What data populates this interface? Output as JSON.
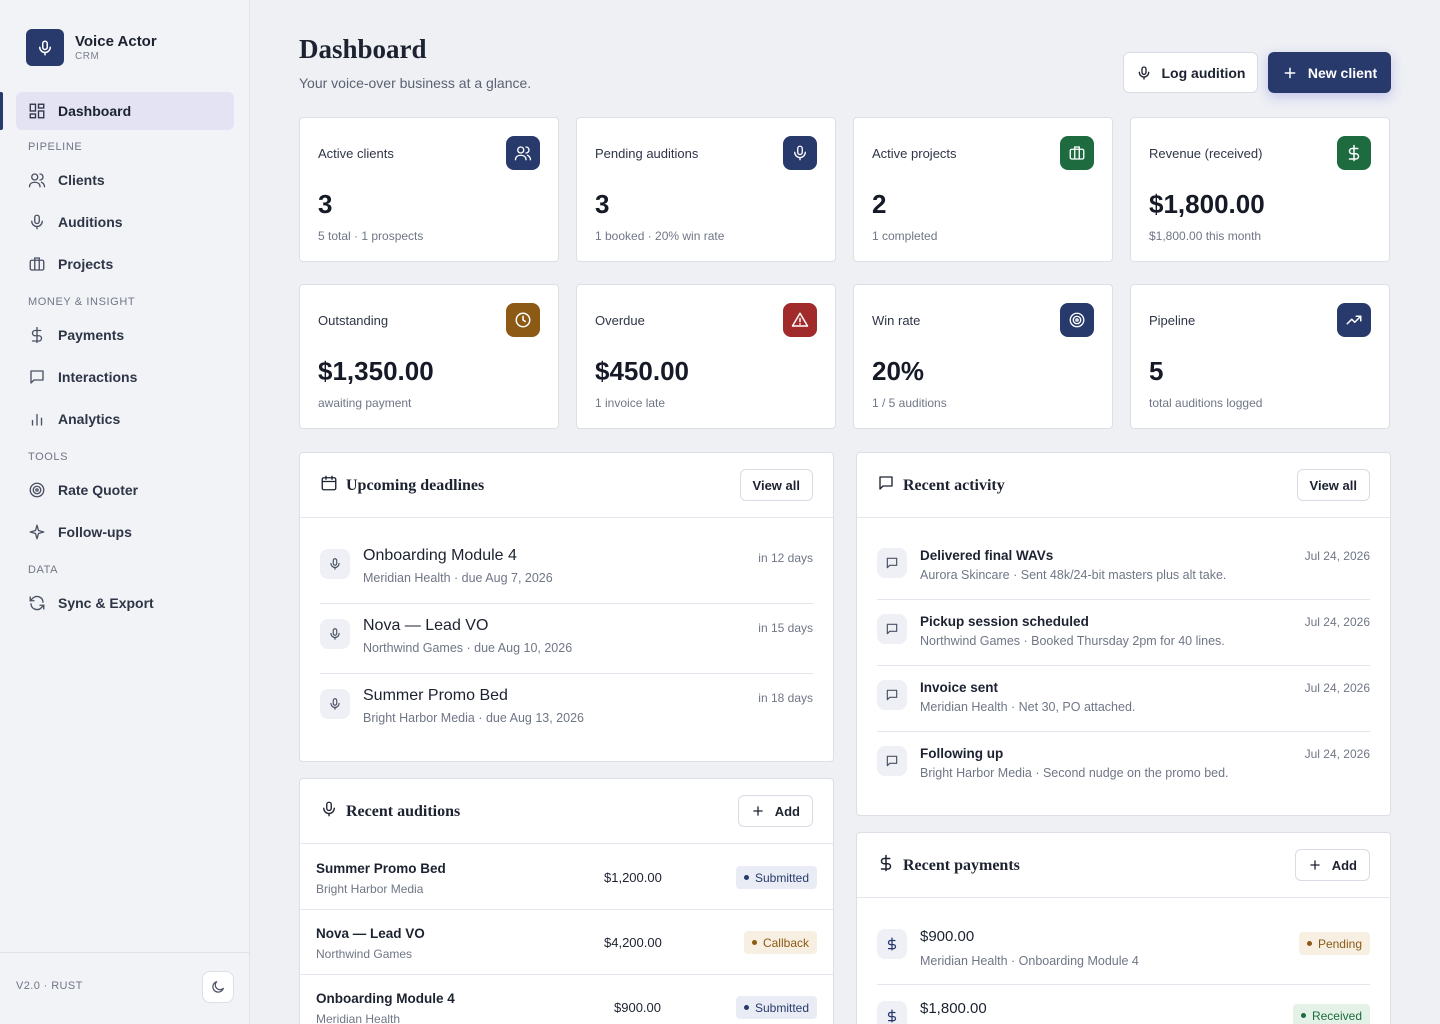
{
  "brand": {
    "title": "Voice Actor",
    "subtitle": "CRM"
  },
  "nav": {
    "dashboard": "Dashboard",
    "pipeline_label": "PIPELINE",
    "clients": "Clients",
    "auditions": "Auditions",
    "projects": "Projects",
    "money_label": "MONEY & INSIGHT",
    "payments": "Payments",
    "interactions": "Interactions",
    "analytics": "Analytics",
    "tools_label": "TOOLS",
    "rate_quoter": "Rate Quoter",
    "followups": "Follow-ups",
    "data_label": "DATA",
    "sync": "Sync & Export"
  },
  "footer": {
    "version": "V2.0 · RUST"
  },
  "header": {
    "title": "Dashboard",
    "subtitle": "Your voice-over business at a glance.",
    "log_audition": "Log audition",
    "new_client": "New client"
  },
  "stats": [
    {
      "label": "Active clients",
      "value": "3",
      "note": "5 total · 1 prospects",
      "icon": "users-icon",
      "color": "#283a6b"
    },
    {
      "label": "Pending auditions",
      "value": "3",
      "note": "1 booked · 20% win rate",
      "icon": "mic-icon",
      "color": "#283a6b"
    },
    {
      "label": "Active projects",
      "value": "2",
      "note": "1 completed",
      "icon": "briefcase-icon",
      "color": "#1d6b3e"
    },
    {
      "label": "Revenue (received)",
      "value": "$1,800.00",
      "note": "$1,800.00 this month",
      "icon": "dollar-icon",
      "color": "#1d6b3e"
    },
    {
      "label": "Outstanding",
      "value": "$1,350.00",
      "note": "awaiting payment",
      "icon": "clock-icon",
      "color": "#8c5a15"
    },
    {
      "label": "Overdue",
      "value": "$450.00",
      "note": "1 invoice late",
      "icon": "alert-icon",
      "color": "#a12a2a"
    },
    {
      "label": "Win rate",
      "value": "20%",
      "note": "1 / 5 auditions",
      "icon": "target-icon",
      "color": "#283a6b"
    },
    {
      "label": "Pipeline",
      "value": "5",
      "note": "total auditions logged",
      "icon": "trend-icon",
      "color": "#283a6b"
    }
  ],
  "deadlines": {
    "title": "Upcoming deadlines",
    "view_all": "View all",
    "items": [
      {
        "title": "Onboarding Module 4",
        "sub": "Meridian Health · due Aug 7, 2026",
        "when": "in 12 days"
      },
      {
        "title": "Nova — Lead VO",
        "sub": "Northwind Games · due Aug 10, 2026",
        "when": "in 15 days"
      },
      {
        "title": "Summer Promo Bed",
        "sub": "Bright Harbor Media · due Aug 13, 2026",
        "when": "in 18 days"
      }
    ]
  },
  "activity": {
    "title": "Recent activity",
    "view_all": "View all",
    "items": [
      {
        "title": "Delivered final WAVs",
        "sub": "Aurora Skincare · Sent 48k/24-bit masters plus alt take.",
        "date": "Jul 24, 2026"
      },
      {
        "title": "Pickup session scheduled",
        "sub": "Northwind Games · Booked Thursday 2pm for 40 lines.",
        "date": "Jul 24, 2026"
      },
      {
        "title": "Invoice sent",
        "sub": "Meridian Health · Net 30, PO attached.",
        "date": "Jul 24, 2026"
      },
      {
        "title": "Following up",
        "sub": "Bright Harbor Media · Second nudge on the promo bed.",
        "date": "Jul 24, 2026"
      }
    ]
  },
  "auditions": {
    "title": "Recent auditions",
    "add": "Add",
    "rows": [
      {
        "title": "Summer Promo Bed",
        "client": "Bright Harbor Media",
        "amount": "$1,200.00",
        "status": "Submitted",
        "status_kind": "submitted"
      },
      {
        "title": "Nova — Lead VO",
        "client": "Northwind Games",
        "amount": "$4,200.00",
        "status": "Callback",
        "status_kind": "callback"
      },
      {
        "title": "Onboarding Module 4",
        "client": "Meridian Health",
        "amount": "$900.00",
        "status": "Submitted",
        "status_kind": "submitted"
      }
    ]
  },
  "payments": {
    "title": "Recent payments",
    "add": "Add",
    "items": [
      {
        "amount": "$900.00",
        "sub": "Meridian Health · Onboarding Module 4",
        "status": "Pending",
        "status_kind": "pending"
      },
      {
        "amount": "$1,800.00",
        "sub": "",
        "status": "Received",
        "status_kind": "received"
      }
    ]
  }
}
